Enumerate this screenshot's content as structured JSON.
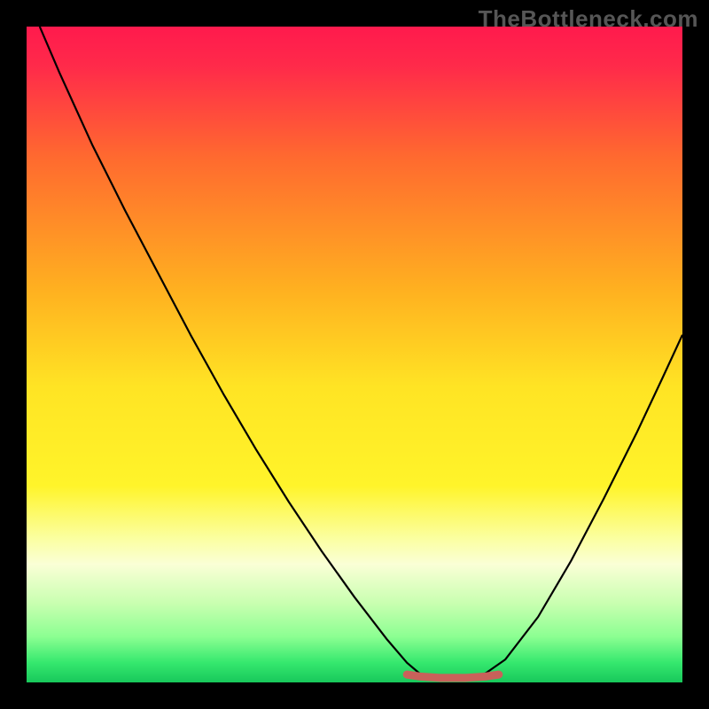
{
  "watermark": "TheBottleneck.com",
  "chart_data": {
    "type": "line",
    "title": "",
    "xlabel": "",
    "ylabel": "",
    "xlim": [
      0,
      100
    ],
    "ylim": [
      0,
      100
    ],
    "background_gradient": {
      "stops": [
        {
          "offset": 0.0,
          "color": "#ff1a4d"
        },
        {
          "offset": 0.06,
          "color": "#ff2a4a"
        },
        {
          "offset": 0.2,
          "color": "#ff6a2f"
        },
        {
          "offset": 0.4,
          "color": "#ffb020"
        },
        {
          "offset": 0.55,
          "color": "#ffe424"
        },
        {
          "offset": 0.7,
          "color": "#fff42a"
        },
        {
          "offset": 0.78,
          "color": "#fbffa0"
        },
        {
          "offset": 0.82,
          "color": "#faffd6"
        },
        {
          "offset": 0.88,
          "color": "#c8ffb0"
        },
        {
          "offset": 0.93,
          "color": "#8cff92"
        },
        {
          "offset": 0.97,
          "color": "#35e86e"
        },
        {
          "offset": 1.0,
          "color": "#18c85b"
        }
      ]
    },
    "series": [
      {
        "name": "bottleneck-curve",
        "color": "#000000",
        "stroke_width": 2.2,
        "points": [
          {
            "x": 2.0,
            "y": 100.0
          },
          {
            "x": 5.0,
            "y": 93.0
          },
          {
            "x": 10.0,
            "y": 82.0
          },
          {
            "x": 15.0,
            "y": 72.0
          },
          {
            "x": 20.0,
            "y": 62.5
          },
          {
            "x": 25.0,
            "y": 53.0
          },
          {
            "x": 30.0,
            "y": 44.0
          },
          {
            "x": 35.0,
            "y": 35.5
          },
          {
            "x": 40.0,
            "y": 27.5
          },
          {
            "x": 45.0,
            "y": 20.0
          },
          {
            "x": 50.0,
            "y": 13.0
          },
          {
            "x": 55.0,
            "y": 6.5
          },
          {
            "x": 58.0,
            "y": 3.0
          },
          {
            "x": 60.0,
            "y": 1.3
          },
          {
            "x": 63.0,
            "y": 0.6
          },
          {
            "x": 67.0,
            "y": 0.6
          },
          {
            "x": 70.0,
            "y": 1.4
          },
          {
            "x": 73.0,
            "y": 3.5
          },
          {
            "x": 78.0,
            "y": 10.0
          },
          {
            "x": 83.0,
            "y": 18.5
          },
          {
            "x": 88.0,
            "y": 28.0
          },
          {
            "x": 93.0,
            "y": 38.0
          },
          {
            "x": 97.0,
            "y": 46.5
          },
          {
            "x": 100.0,
            "y": 53.0
          }
        ]
      },
      {
        "name": "optimal-range-marker",
        "color": "#c9615a",
        "stroke_width": 9,
        "linecap": "round",
        "points": [
          {
            "x": 58.0,
            "y": 1.2
          },
          {
            "x": 60.0,
            "y": 0.9
          },
          {
            "x": 63.0,
            "y": 0.7
          },
          {
            "x": 67.0,
            "y": 0.7
          },
          {
            "x": 70.0,
            "y": 0.9
          },
          {
            "x": 72.0,
            "y": 1.2
          }
        ]
      }
    ]
  }
}
